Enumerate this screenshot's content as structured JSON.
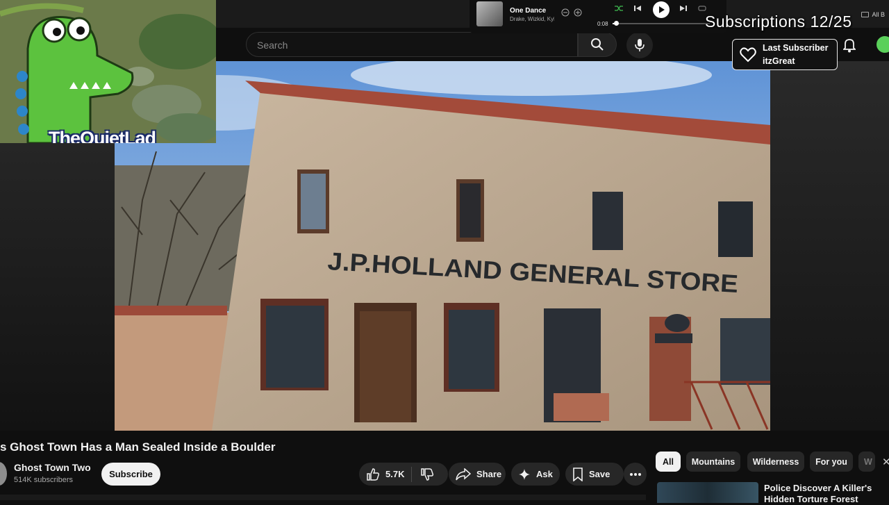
{
  "browser": {
    "bookmark_label": "All B"
  },
  "search": {
    "placeholder": "Search",
    "search_icon": "search-icon",
    "mic_icon": "mic-icon"
  },
  "overlay": {
    "streamer_name": "TheQuietLad",
    "subscriptions_label": "Subscriptions 12/25",
    "last_subscriber_label": "Last Subscriber",
    "last_subscriber_name": "itzGreat"
  },
  "player": {
    "song_title": "One Dance",
    "artists": "Drake, Wizkid, Kyla",
    "elapsed": "0:08",
    "progress_fraction": 0.03
  },
  "video": {
    "sign_text": "J.P.HOLLAND GENERAL STORE",
    "title": "s Ghost Town Has a Man Sealed Inside a Boulder"
  },
  "channel": {
    "name": "Ghost Town Two",
    "subscribers": "514K subscribers",
    "subscribe_label": "Subscribe"
  },
  "actions": {
    "like_count": "5.7K",
    "share_label": "Share",
    "ask_label": "Ask",
    "save_label": "Save"
  },
  "chips": [
    "All",
    "Mountains",
    "Wilderness",
    "For you",
    "W"
  ],
  "recommended": {
    "title": "Police Discover A Killer's Hidden Torture Forest"
  },
  "colors": {
    "background": "#0f0f0f",
    "pill": "#272727",
    "active_chip": "#f1f1f1",
    "avatar_green": "#5ad05a"
  }
}
